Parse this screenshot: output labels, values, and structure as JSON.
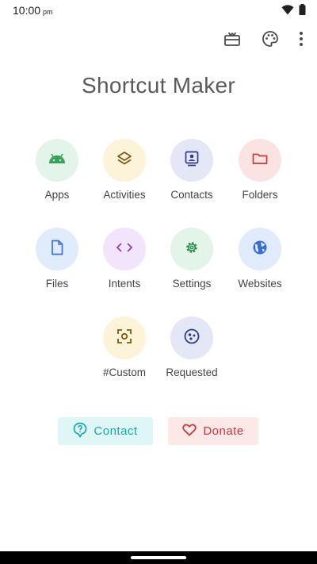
{
  "status_bar": {
    "time": "10:00",
    "ampm": "pm"
  },
  "app": {
    "title": "Shortcut Maker"
  },
  "grid": [
    {
      "label": "Apps",
      "icon": "android-icon",
      "bg": "#e3f4e8",
      "fg": "#3aa05a"
    },
    {
      "label": "Activities",
      "icon": "layers-icon",
      "bg": "#fdf3d9",
      "fg": "#7a5b10"
    },
    {
      "label": "Contacts",
      "icon": "contact-card-icon",
      "bg": "#e4e8f6",
      "fg": "#2f3a8a"
    },
    {
      "label": "Folders",
      "icon": "folder-icon",
      "bg": "#fbe3e3",
      "fg": "#c73a3a"
    },
    {
      "label": "Files",
      "icon": "file-icon",
      "bg": "#e0ebfb",
      "fg": "#3f6fd8"
    },
    {
      "label": "Intents",
      "icon": "code-icon",
      "bg": "#f2e4fa",
      "fg": "#8e3fb5"
    },
    {
      "label": "Settings",
      "icon": "gear-icon",
      "bg": "#e3f4e8",
      "fg": "#2f8f4e"
    },
    {
      "label": "Websites",
      "icon": "globe-icon",
      "bg": "#e0ebfb",
      "fg": "#3a6fd0"
    },
    {
      "label": "#Custom",
      "icon": "scan-focus-icon",
      "bg": "#fdf3d9",
      "fg": "#7a5b10"
    },
    {
      "label": "Requested",
      "icon": "face-cookie-icon",
      "bg": "#e4e8f6",
      "fg": "#2f3a8a"
    }
  ],
  "buttons": {
    "contact_label": "Contact",
    "donate_label": "Donate"
  }
}
